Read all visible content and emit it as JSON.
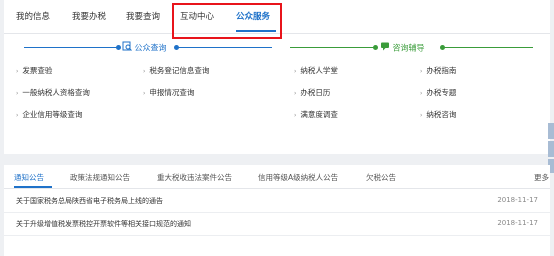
{
  "tabs": [
    {
      "label": "我的信息"
    },
    {
      "label": "我要办税"
    },
    {
      "label": "我要查询"
    },
    {
      "label": "互动中心"
    },
    {
      "label": "公众服务"
    }
  ],
  "public_query": {
    "title": "公众查询",
    "items": [
      "发票查验",
      "税务登记信息查询",
      "一般纳税人资格查询",
      "申报情况查询",
      "企业信用等级查询"
    ]
  },
  "consult": {
    "title": "咨询辅导",
    "items": [
      "纳税人学堂",
      "办税指南",
      "办税日历",
      "办税专题",
      "满意度调查",
      "纳税咨询"
    ]
  },
  "notice_tabs": [
    {
      "label": "通知公告"
    },
    {
      "label": "政策法规通知公告"
    },
    {
      "label": "重大税收违法案件公告"
    },
    {
      "label": "信用等级A级纳税人公告"
    },
    {
      "label": "欠税公告"
    }
  ],
  "more_label": "更多",
  "news": [
    {
      "title": "关于国家税务总局陕西省电子税务局上线的通告",
      "date": "2018-11-17"
    },
    {
      "title": "关于升级增值税发票税控开票软件等相关接口规范的通知",
      "date": "2018-11-17"
    }
  ],
  "colors": {
    "accent": "#1f72c9",
    "green": "#3a9c3a",
    "highlight": "#e8141b"
  }
}
